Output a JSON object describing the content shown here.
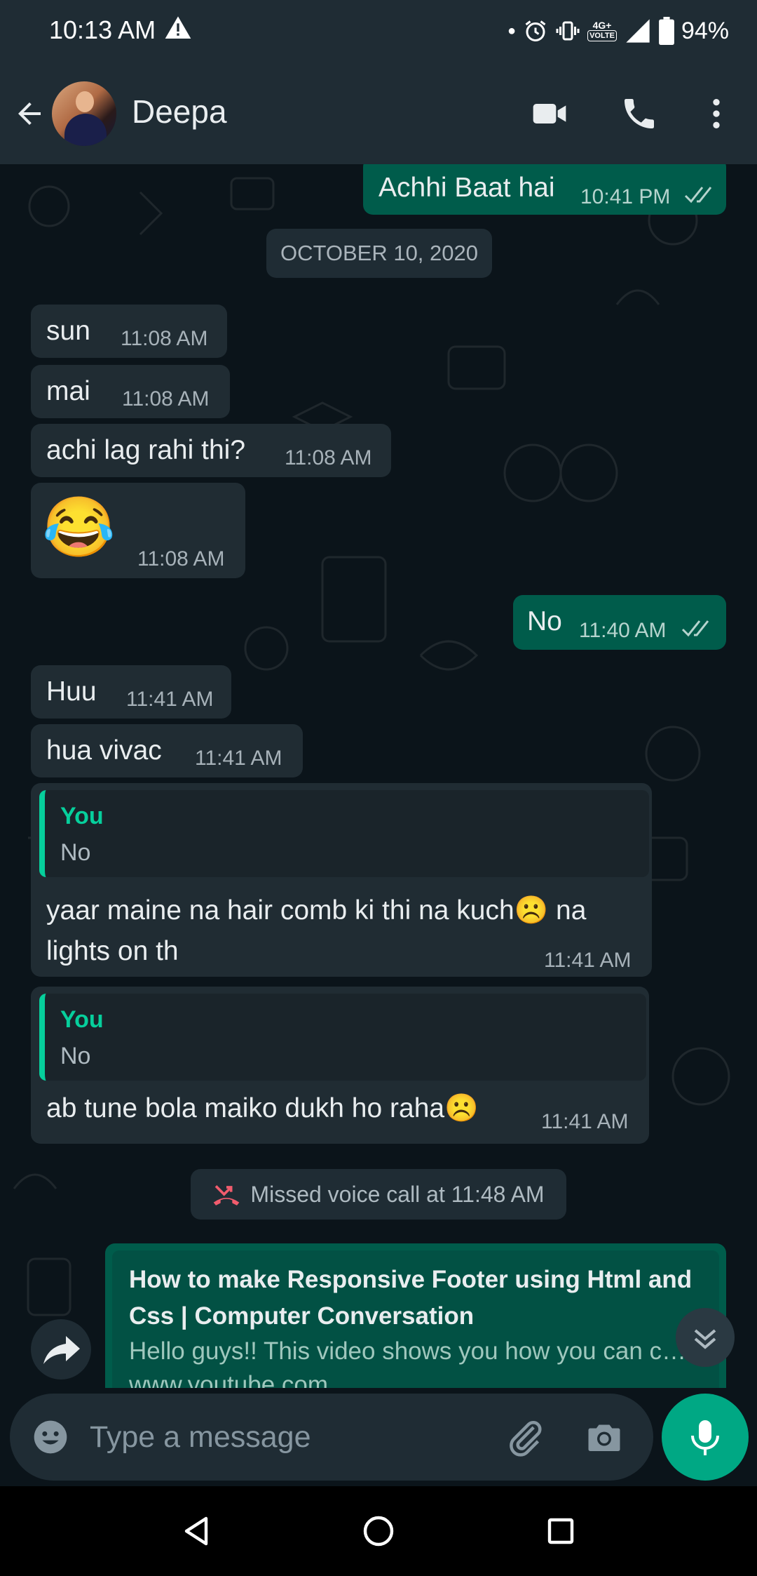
{
  "status_bar": {
    "time": "10:13 AM",
    "network": "4G+",
    "volte": "VOLTE",
    "battery": "94%"
  },
  "header": {
    "contact_name": "Deepa"
  },
  "date_divider": "OCTOBER 10, 2020",
  "messages": [
    {
      "dir": "out",
      "text": "Achhi Baat hai",
      "time": "10:41 PM",
      "read": true
    },
    {
      "dir": "in",
      "text": "sun",
      "time": "11:08 AM"
    },
    {
      "dir": "in",
      "text": "mai",
      "time": "11:08 AM"
    },
    {
      "dir": "in",
      "text": "achi lag rahi thi?",
      "time": "11:08 AM"
    },
    {
      "dir": "in",
      "emoji": "😂",
      "time": "11:08 AM"
    },
    {
      "dir": "out",
      "text": "No",
      "time": "11:40 AM",
      "read": true
    },
    {
      "dir": "in",
      "text": "Huu",
      "time": "11:41 AM"
    },
    {
      "dir": "in",
      "text": "hua vivac",
      "time": "11:41 AM"
    },
    {
      "dir": "in",
      "quote_author": "You",
      "quote_text": "No",
      "text_line1": "yaar maine na hair comb ki thi na kuch☹️ na",
      "text_line2": "lights on th",
      "time": "11:41 AM"
    },
    {
      "dir": "in",
      "quote_author": "You",
      "quote_text": "No",
      "text": "ab tune bola maiko dukh ho raha☹️",
      "time": "11:41 AM"
    }
  ],
  "missed_call": "Missed voice call at 11:48 AM",
  "link_preview": {
    "title": "How to make Responsive Footer using Html and Css | Computer Conversation",
    "description": "Hello guys!! This video shows you how you can c…",
    "domain": "www.youtube.com"
  },
  "input": {
    "placeholder": "Type a message"
  },
  "colors": {
    "accent": "#00a884",
    "outgoing_bubble": "#005c4b",
    "incoming_bubble": "#202c33",
    "quote_author": "#06cf9c",
    "missed_call_icon": "#f15c6d"
  }
}
